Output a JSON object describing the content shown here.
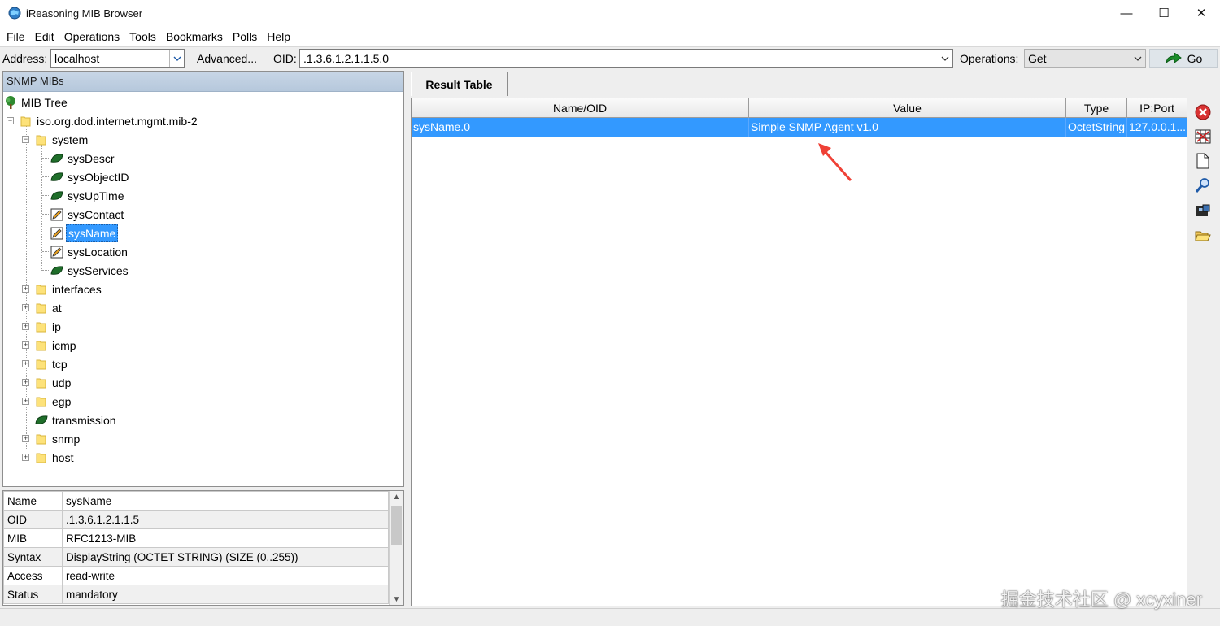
{
  "window": {
    "title": "iReasoning MIB Browser",
    "controls": {
      "minimize": "—",
      "maximize": "☐",
      "close": "✕"
    }
  },
  "menu": [
    "File",
    "Edit",
    "Operations",
    "Tools",
    "Bookmarks",
    "Polls",
    "Help"
  ],
  "toolbar": {
    "address_label": "Address:",
    "address_value": "localhost",
    "advanced_label": "Advanced...",
    "oid_label": "OID:",
    "oid_value": ".1.3.6.1.2.1.1.5.0",
    "operations_label": "Operations:",
    "operations_value": "Get",
    "go_label": "Go"
  },
  "left_panel": {
    "header": "SNMP MIBs",
    "tree": {
      "root": "MIB Tree",
      "mib2": "iso.org.dod.internet.mgmt.mib-2",
      "system": "system",
      "system_children": [
        {
          "label": "sysDescr",
          "icon": "leaf-icon"
        },
        {
          "label": "sysObjectID",
          "icon": "leaf-icon"
        },
        {
          "label": "sysUpTime",
          "icon": "leaf-icon"
        },
        {
          "label": "sysContact",
          "icon": "writable-icon"
        },
        {
          "label": "sysName",
          "icon": "writable-icon",
          "selected": true
        },
        {
          "label": "sysLocation",
          "icon": "writable-icon"
        },
        {
          "label": "sysServices",
          "icon": "leaf-icon"
        }
      ],
      "groups": [
        {
          "label": "interfaces",
          "type": "folder"
        },
        {
          "label": "at",
          "type": "folder"
        },
        {
          "label": "ip",
          "type": "folder"
        },
        {
          "label": "icmp",
          "type": "folder"
        },
        {
          "label": "tcp",
          "type": "folder"
        },
        {
          "label": "udp",
          "type": "folder"
        },
        {
          "label": "egp",
          "type": "folder"
        },
        {
          "label": "transmission",
          "type": "leaf"
        },
        {
          "label": "snmp",
          "type": "folder"
        },
        {
          "label": "host",
          "type": "folder"
        }
      ]
    }
  },
  "properties": [
    {
      "key": "Name",
      "value": "sysName"
    },
    {
      "key": "OID",
      "value": ".1.3.6.1.2.1.1.5"
    },
    {
      "key": "MIB",
      "value": "RFC1213-MIB"
    },
    {
      "key": "Syntax",
      "value": "DisplayString (OCTET STRING) (SIZE (0..255))"
    },
    {
      "key": "Access",
      "value": "read-write"
    },
    {
      "key": "Status",
      "value": "mandatory"
    }
  ],
  "result": {
    "tab": "Result Table",
    "columns": [
      "Name/OID",
      "Value",
      "Type",
      "IP:Port"
    ],
    "rows": [
      {
        "name": "sysName.0",
        "value": "Simple SNMP Agent v1.0",
        "type": "OctetString",
        "ipport": "127.0.0.1..."
      }
    ]
  },
  "side_tools": [
    "delete-icon",
    "table-view-icon",
    "document-icon",
    "find-icon",
    "save-icon",
    "open-folder-icon"
  ],
  "colors": {
    "selection": "#3399ff",
    "header_blue": "#b6c8dc",
    "arrow": "#ef4136"
  },
  "watermark": "掘金技术社区 @ xcyxiner"
}
